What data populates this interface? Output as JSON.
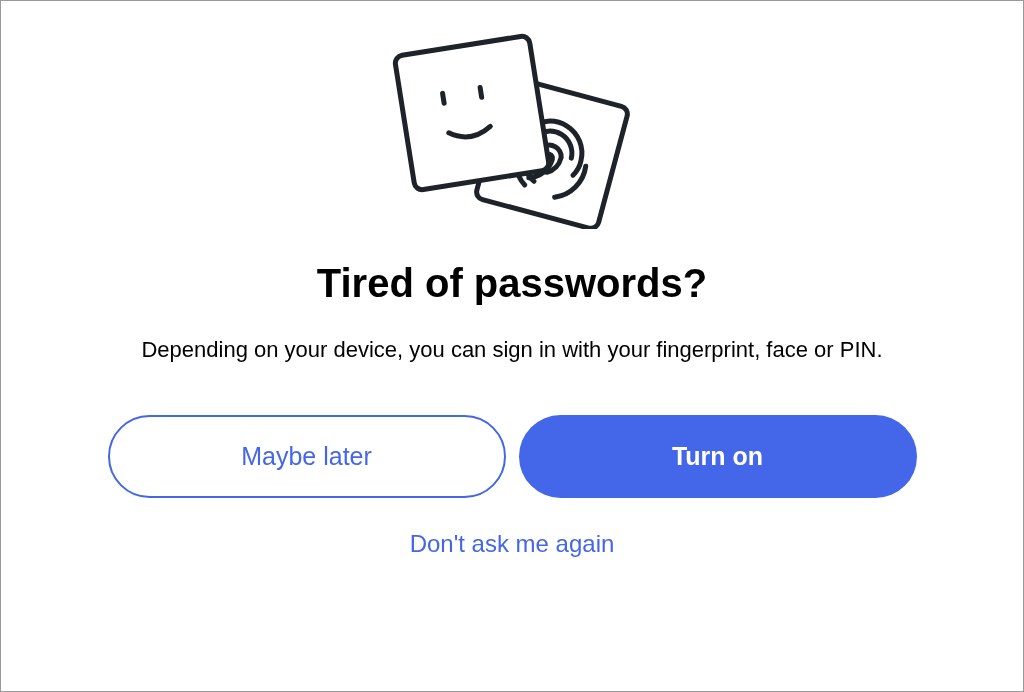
{
  "title": "Tired of passwords?",
  "message": "Depending on your device, you can sign in with your fingerprint, face or PIN.",
  "buttons": [
    {
      "label": "Maybe later",
      "kind": "secondary"
    },
    {
      "label": "Turn on",
      "kind": "primary"
    }
  ],
  "link": "Don't ask me again"
}
